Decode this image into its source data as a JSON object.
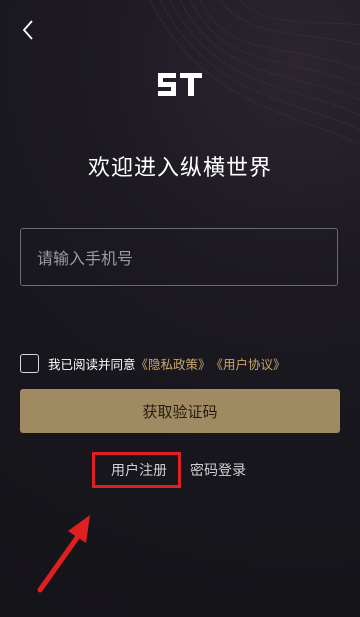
{
  "header": {
    "back_icon": "chevron-left-icon"
  },
  "brand": {
    "logo_icon": "brand-logo"
  },
  "title": "欢迎进入纵横世界",
  "phone_input": {
    "value": "",
    "placeholder": "请输入手机号"
  },
  "agreement": {
    "prefix": "我已阅读并同意",
    "privacy_link": "《隐私政策》",
    "user_link": "《用户协议》",
    "checked": false
  },
  "buttons": {
    "get_code": "获取验证码"
  },
  "links": {
    "register": "用户注册",
    "password_login": "密码登录"
  },
  "annotation": {
    "highlight_color": "#e02020",
    "arrow_icon": "red-arrow-icon"
  },
  "colors": {
    "accent": "#a08a62",
    "link": "#c9a76c",
    "background": "#17161c"
  }
}
